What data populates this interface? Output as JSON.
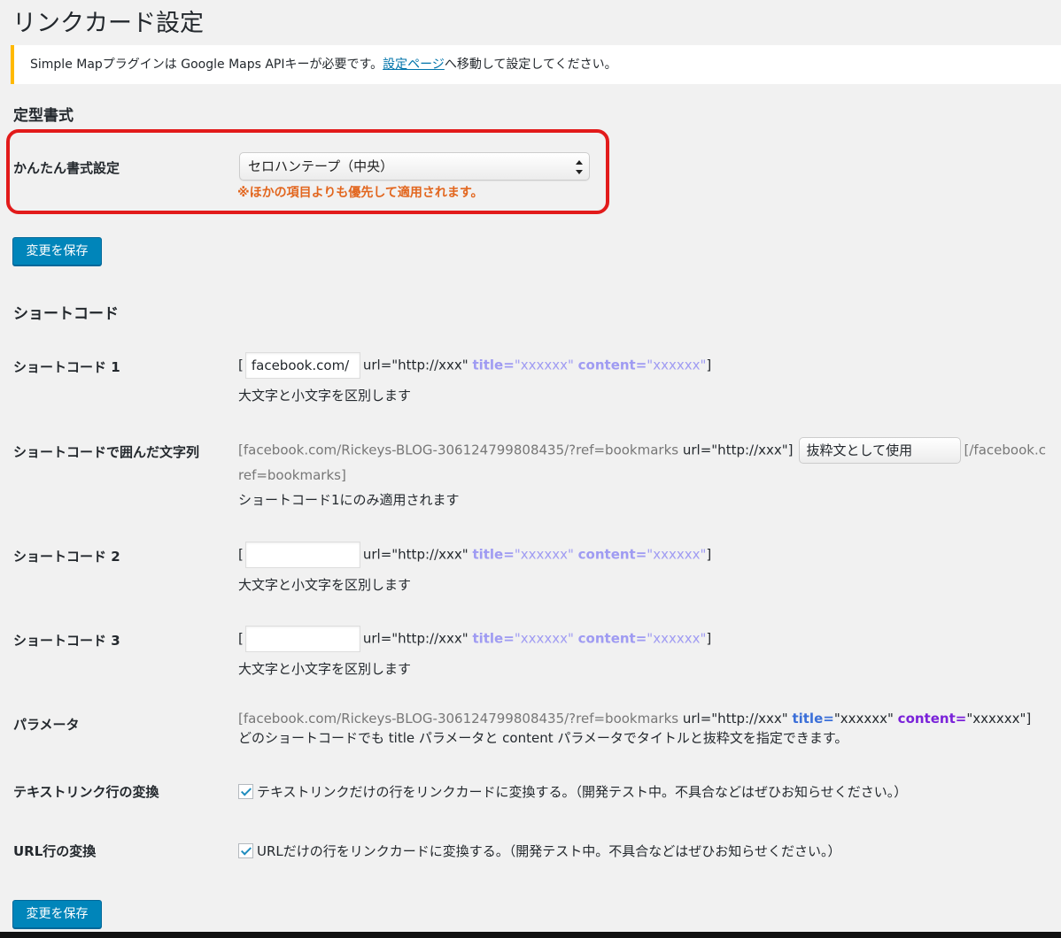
{
  "page": {
    "title": "リンクカード設定"
  },
  "notice": {
    "text_before": "Simple Mapプラグインは Google Maps APIキーが必要です。",
    "link": "設定ページ",
    "text_after": "へ移動して設定してください。"
  },
  "format_section": {
    "title": "定型書式",
    "easy_format": {
      "label": "かんたん書式設定",
      "selected": "セロハンテープ（中央）",
      "warning": "※ほかの項目よりも優先して適用されます。"
    },
    "save_label": "変更を保存"
  },
  "shortcode_section": {
    "title": "ショートコード",
    "shortcode1": {
      "label": "ショートコード 1",
      "open_bracket": "[",
      "value": "facebook.com/",
      "url_attr": "url=\"http://xxx\"",
      "title_attr": "title=",
      "title_val": "\"xxxxxx\"",
      "content_attr": "content=",
      "content_val": "\"xxxxxx\"",
      "close_bracket": "]",
      "desc": "大文字と小文字を区別します"
    },
    "enclosed": {
      "label": "ショートコードで囲んだ文字列",
      "prefix": "[facebook.com/Rickeys-BLOG-306124799808435/?ref=bookmarks",
      "url_attr": "url=\"http://xxx\"]",
      "selected": "抜粋文として使用",
      "suffix": "[/facebook.c",
      "wrap": "ref=bookmarks]",
      "desc": "ショートコード1にのみ適用されます"
    },
    "shortcode2": {
      "label": "ショートコード 2",
      "open_bracket": "[",
      "value": "",
      "url_attr": "url=\"http://xxx\"",
      "title_attr": "title=",
      "title_val": "\"xxxxxx\"",
      "content_attr": "content=",
      "content_val": "\"xxxxxx\"",
      "close_bracket": "]",
      "desc": "大文字と小文字を区別します"
    },
    "shortcode3": {
      "label": "ショートコード 3",
      "open_bracket": "[",
      "value": "",
      "url_attr": "url=\"http://xxx\"",
      "title_attr": "title=",
      "title_val": "\"xxxxxx\"",
      "content_attr": "content=",
      "content_val": "\"xxxxxx\"",
      "close_bracket": "]",
      "desc": "大文字と小文字を区別します"
    },
    "parameter": {
      "label": "パラメータ",
      "prefix": "[facebook.com/Rickeys-BLOG-306124799808435/?ref=bookmarks",
      "url_attr": "url=\"http://xxx\"",
      "title_attr": "title=",
      "title_val": "\"xxxxxx\"",
      "content_attr": "content=",
      "content_val": "\"xxxxxx\"]",
      "desc": "どのショートコードでも title パラメータと content パラメータでタイトルと抜粋文を指定できます。"
    },
    "text_link": {
      "label": "テキストリンク行の変換",
      "checked": true,
      "text": "テキストリンクだけの行をリンクカードに変換する。（開発テスト中。不具合などはぜひお知らせください。）"
    },
    "url_line": {
      "label": "URL行の変換",
      "checked": true,
      "text": "URLだけの行をリンクカードに変換する。（開発テスト中。不具合などはぜひお知らせください。）"
    },
    "save_label": "変更を保存"
  },
  "colors": {
    "primary_button": "#0085ba",
    "notice_border": "#ffb900",
    "warning_text": "#e2661e",
    "highlight_border": "#e21b1b",
    "attr_soft": "#9f9bf2",
    "attr_title": "#3b6fd8",
    "attr_content": "#7a22d9"
  }
}
